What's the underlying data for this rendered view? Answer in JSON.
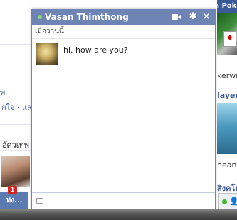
{
  "chat": {
    "contact_name": "Vasan Thimthong",
    "status": "เมื่อวานนี้",
    "messages": [
      {
        "text": "hi. how are you?"
      }
    ],
    "input_value": "",
    "title_bg_color": "#6d84b4",
    "online_color": "#8bd47f",
    "icons": {
      "online": "online-dot",
      "video": "video-camera-icon",
      "settings": "gear-icon",
      "close": "close-icon",
      "input": "speech-bubble-icon"
    }
  },
  "background": {
    "left_texts": [
      "พ",
      "กใจ · แสด",
      "อัศวเทพ"
    ],
    "left_tab_label": "ห่ง...",
    "notification_count": "1",
    "right_header": "Texas HoldEm Pok",
    "right_texts": [
      "kerwm",
      "layers",
      "heans",
      "สิงคโป"
    ]
  }
}
